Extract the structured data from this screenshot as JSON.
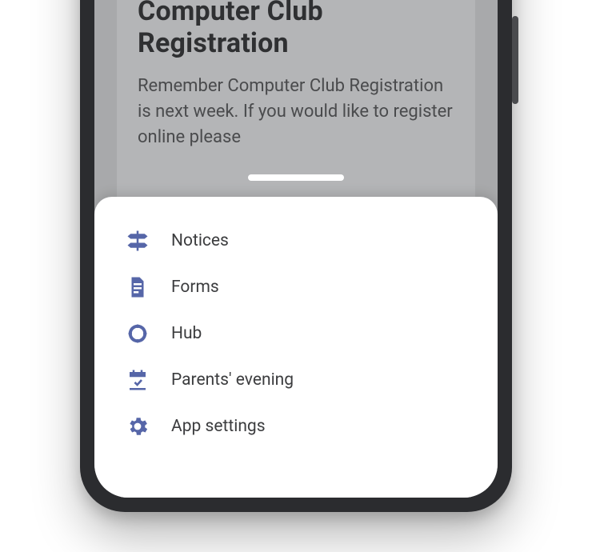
{
  "colors": {
    "accent": "#5666a8"
  },
  "card": {
    "title": "Computer Club Registration",
    "body": "Remember Computer Club Registration is next week. If you would like to register online please"
  },
  "menu": {
    "items": [
      {
        "label": "Notices",
        "icon": "signpost-icon"
      },
      {
        "label": "Forms",
        "icon": "document-icon"
      },
      {
        "label": "Hub",
        "icon": "ring-icon"
      },
      {
        "label": "Parents' evening",
        "icon": "calendar-check-icon"
      },
      {
        "label": "App settings",
        "icon": "gear-icon"
      }
    ]
  }
}
